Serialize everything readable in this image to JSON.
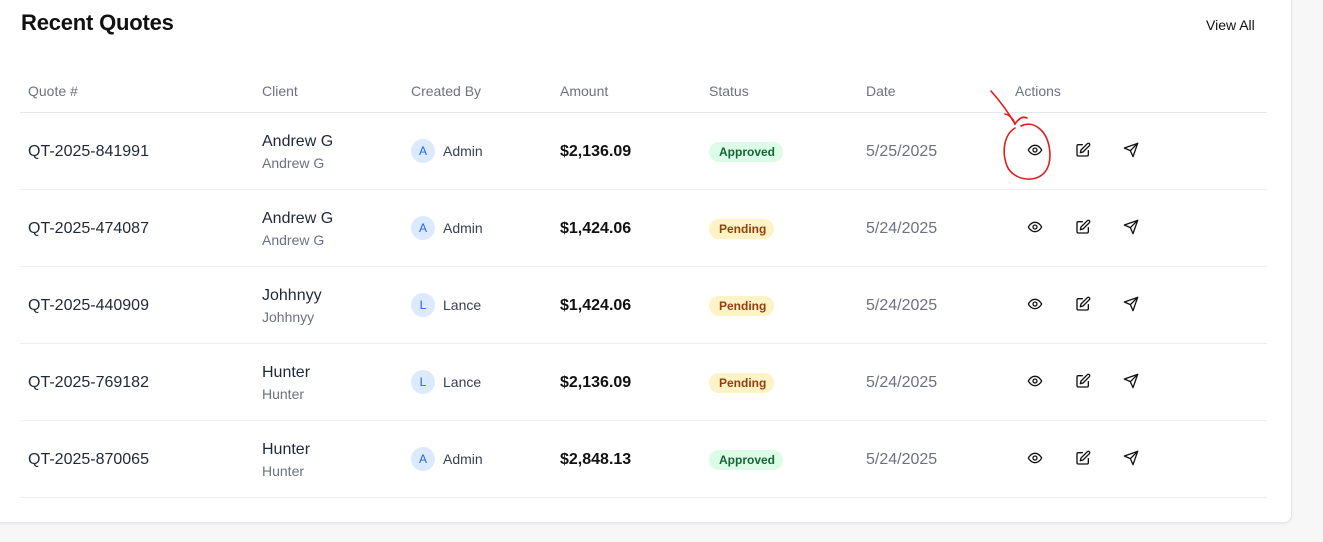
{
  "header": {
    "title": "Recent Quotes",
    "view_all_label": "View All"
  },
  "table": {
    "columns": [
      "Quote #",
      "Client",
      "Created By",
      "Amount",
      "Status",
      "Date",
      "Actions"
    ],
    "rows": [
      {
        "quote": "QT-2025-841991",
        "client_name": "Andrew G",
        "client_sub": "Andrew G",
        "creator_initial": "A",
        "creator": "Admin",
        "amount": "$2,136.09",
        "status": "Approved",
        "status_type": "approved",
        "date": "5/25/2025"
      },
      {
        "quote": "QT-2025-474087",
        "client_name": "Andrew G",
        "client_sub": "Andrew G",
        "creator_initial": "A",
        "creator": "Admin",
        "amount": "$1,424.06",
        "status": "Pending",
        "status_type": "pending",
        "date": "5/24/2025"
      },
      {
        "quote": "QT-2025-440909",
        "client_name": "Johhnyy",
        "client_sub": "Johhnyy",
        "creator_initial": "L",
        "creator": "Lance",
        "amount": "$1,424.06",
        "status": "Pending",
        "status_type": "pending",
        "date": "5/24/2025"
      },
      {
        "quote": "QT-2025-769182",
        "client_name": "Hunter",
        "client_sub": "Hunter",
        "creator_initial": "L",
        "creator": "Lance",
        "amount": "$2,136.09",
        "status": "Pending",
        "status_type": "pending",
        "date": "5/24/2025"
      },
      {
        "quote": "QT-2025-870065",
        "client_name": "Hunter",
        "client_sub": "Hunter",
        "creator_initial": "A",
        "creator": "Admin",
        "amount": "$2,848.13",
        "status": "Approved",
        "status_type": "approved",
        "date": "5/24/2025"
      }
    ],
    "row_actions": [
      "eye-icon",
      "edit-icon",
      "send-icon"
    ]
  },
  "colors": {
    "approved_bg": "#dcfce7",
    "approved_text": "#166534",
    "pending_bg": "#fef3c7",
    "pending_text": "#92400e",
    "avatar_bg": "#dbeafe",
    "annotation_red": "#e11d1d"
  }
}
